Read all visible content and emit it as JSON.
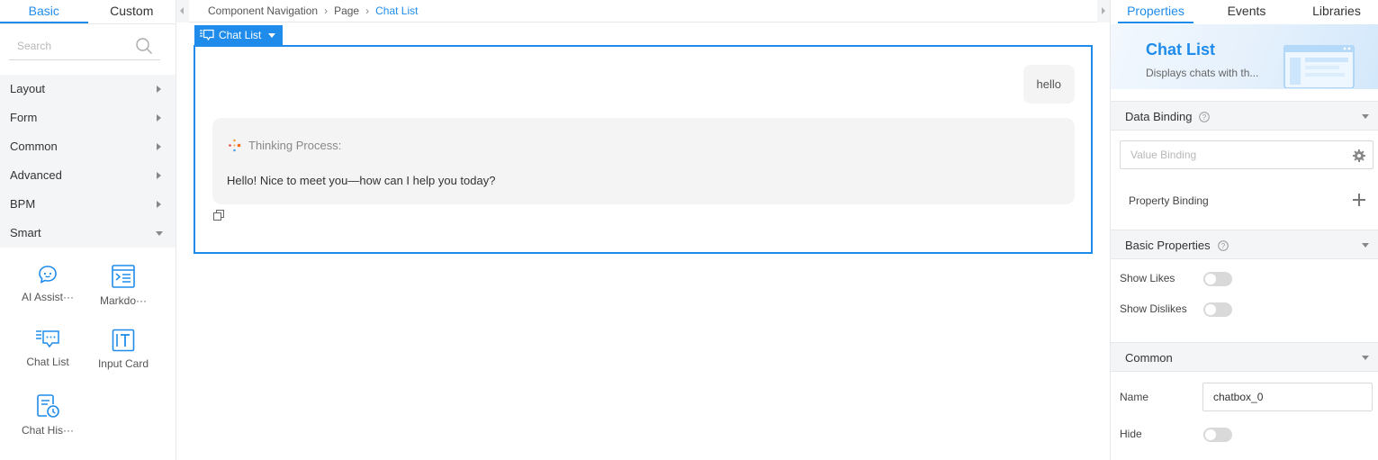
{
  "left_panel": {
    "tabs": [
      "Basic",
      "Custom"
    ],
    "search": {
      "placeholder": "Search",
      "value": ""
    },
    "categories": [
      {
        "label": "Layout",
        "expanded": false
      },
      {
        "label": "Form",
        "expanded": false
      },
      {
        "label": "Common",
        "expanded": false
      },
      {
        "label": "Advanced",
        "expanded": false
      },
      {
        "label": "BPM",
        "expanded": false
      },
      {
        "label": "Smart",
        "expanded": true
      }
    ],
    "components": [
      {
        "label": "AI Assist···",
        "icon": "ai-assistant-icon"
      },
      {
        "label": "Markdo···",
        "icon": "markdown-icon"
      },
      {
        "label": "Chat List",
        "icon": "chat-list-icon"
      },
      {
        "label": "Input Card",
        "icon": "input-card-icon"
      },
      {
        "label": "Chat His···",
        "icon": "chat-history-icon"
      }
    ]
  },
  "breadcrumb": [
    "Component Navigation",
    "Page",
    "Chat List"
  ],
  "canvas": {
    "selected_tag": "Chat List",
    "user_message": "hello",
    "thinking_label": "Thinking Process:",
    "ai_message": "Hello! Nice to meet you—how can I help you today?"
  },
  "right_panel": {
    "tabs": [
      "Properties",
      "Events",
      "Libraries"
    ],
    "component_title": "Chat List",
    "component_desc": "Displays chats with th...",
    "sections": {
      "data_binding": "Data Binding",
      "basic_properties": "Basic Properties",
      "common": "Common"
    },
    "value_binding_placeholder": "Value Binding",
    "property_binding_label": "Property Binding",
    "show_likes_label": "Show Likes",
    "show_likes_on": false,
    "show_dislikes_label": "Show Dislikes",
    "show_dislikes_on": false,
    "name_label": "Name",
    "name_value": "chatbox_0",
    "hide_label": "Hide",
    "hide_on": false
  },
  "colors": {
    "accent": "#1f8ceb",
    "panel_bg": "#f4f5f7",
    "bubble_bg": "#f4f4f5"
  }
}
